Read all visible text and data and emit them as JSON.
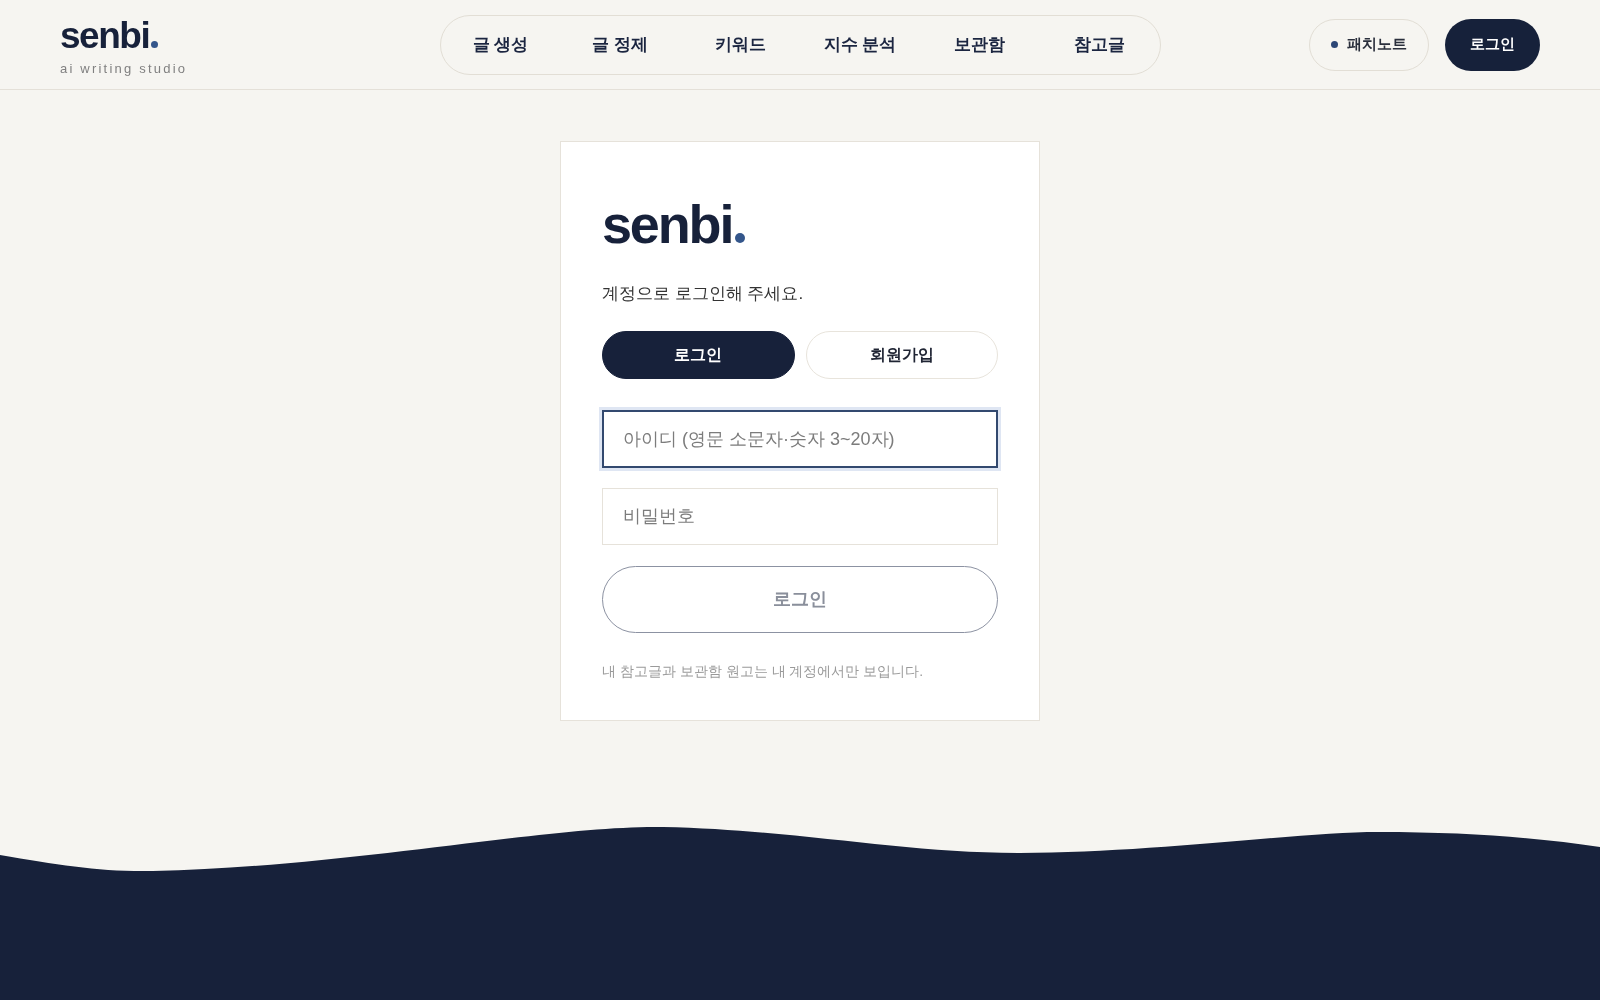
{
  "header": {
    "logo": {
      "wordmark": "senbi",
      "tagline": "ai writing studio"
    },
    "nav": [
      {
        "label": "글 생성",
        "selected": false
      },
      {
        "label": "글 정제",
        "selected": false
      },
      {
        "label": "키워드",
        "selected": false
      },
      {
        "label": "지수 분석",
        "selected": false
      },
      {
        "label": "보관함",
        "selected": false
      },
      {
        "label": "참고글",
        "selected": false
      }
    ],
    "patch_notes": {
      "label": "패치노트"
    },
    "login_button": {
      "label": "로그인"
    }
  },
  "login_card": {
    "logo": {
      "wordmark": "senbi"
    },
    "subtitle": "계정으로 로그인해 주세요.",
    "tabs": [
      {
        "label": "로그인",
        "selected": true
      },
      {
        "label": "회원가입",
        "selected": false
      }
    ],
    "fields": [
      {
        "placeholder": "아이디 (영문 소문자·숫자 3~20자)",
        "focused": true
      },
      {
        "placeholder": "비밀번호",
        "focused": false
      }
    ],
    "submit": {
      "label": "로그인",
      "disabled": true
    },
    "note": "내 참고글과 보관함 원고는 내 계정에서만 보입니다."
  }
}
